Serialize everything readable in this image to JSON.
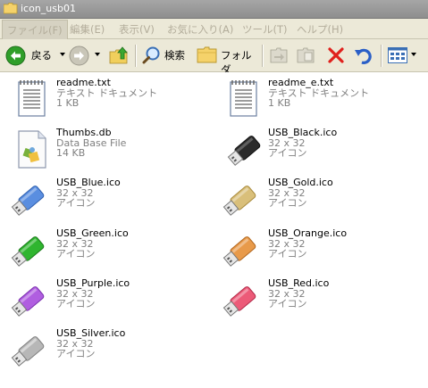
{
  "window": {
    "title": "icon_usb01"
  },
  "menu": [
    {
      "label": "ファイル(F)"
    },
    {
      "label": "編集(E)"
    },
    {
      "label": "表示(V)"
    },
    {
      "label": "お気に入り(A)"
    },
    {
      "label": "ツール(T)"
    },
    {
      "label": "ヘルプ(H)"
    }
  ],
  "toolbar": {
    "back_label": "戻る",
    "search_label": "検索",
    "folders_label": "フォルダ"
  },
  "colors": {
    "title_bar": "#9a9a9a",
    "chrome": "#ece9d8",
    "back_green": "#2f9e29",
    "delete_red": "#e0201c",
    "undo_blue": "#2a5fc7"
  },
  "files": [
    {
      "name": "readme.txt",
      "type": "テキスト ドキュメント",
      "size": "1 KB",
      "icon": "text-document-icon"
    },
    {
      "name": "readme_e.txt",
      "type": "テキスト ドキュメント",
      "size": "1 KB",
      "icon": "text-document-icon"
    },
    {
      "name": "Thumbs.db",
      "type": "Data Base File",
      "size": "14 KB",
      "icon": "database-file-icon"
    },
    {
      "name": "USB_Black.ico",
      "type": "32 x 32",
      "size": "アイコン",
      "icon": "usb-black-icon",
      "color": "#2b2b2b"
    },
    {
      "name": "USB_Blue.ico",
      "type": "32 x 32",
      "size": "アイコン",
      "icon": "usb-blue-icon",
      "color": "#5a8ee0"
    },
    {
      "name": "USB_Gold.ico",
      "type": "32 x 32",
      "size": "アイコン",
      "icon": "usb-gold-icon",
      "color": "#d9bf7a"
    },
    {
      "name": "USB_Green.ico",
      "type": "32 x 32",
      "size": "アイコン",
      "icon": "usb-green-icon",
      "color": "#2fb52f"
    },
    {
      "name": "USB_Orange.ico",
      "type": "32 x 32",
      "size": "アイコン",
      "icon": "usb-orange-icon",
      "color": "#e89a4a"
    },
    {
      "name": "USB_Purple.ico",
      "type": "32 x 32",
      "size": "アイコン",
      "icon": "usb-purple-icon",
      "color": "#b05ee0"
    },
    {
      "name": "USB_Red.ico",
      "type": "32 x 32",
      "size": "アイコン",
      "icon": "usb-red-icon",
      "color": "#ec5a78"
    },
    {
      "name": "USB_Silver.ico",
      "type": "32 x 32",
      "size": "アイコン",
      "icon": "usb-silver-icon",
      "color": "#b7b7b7"
    }
  ]
}
